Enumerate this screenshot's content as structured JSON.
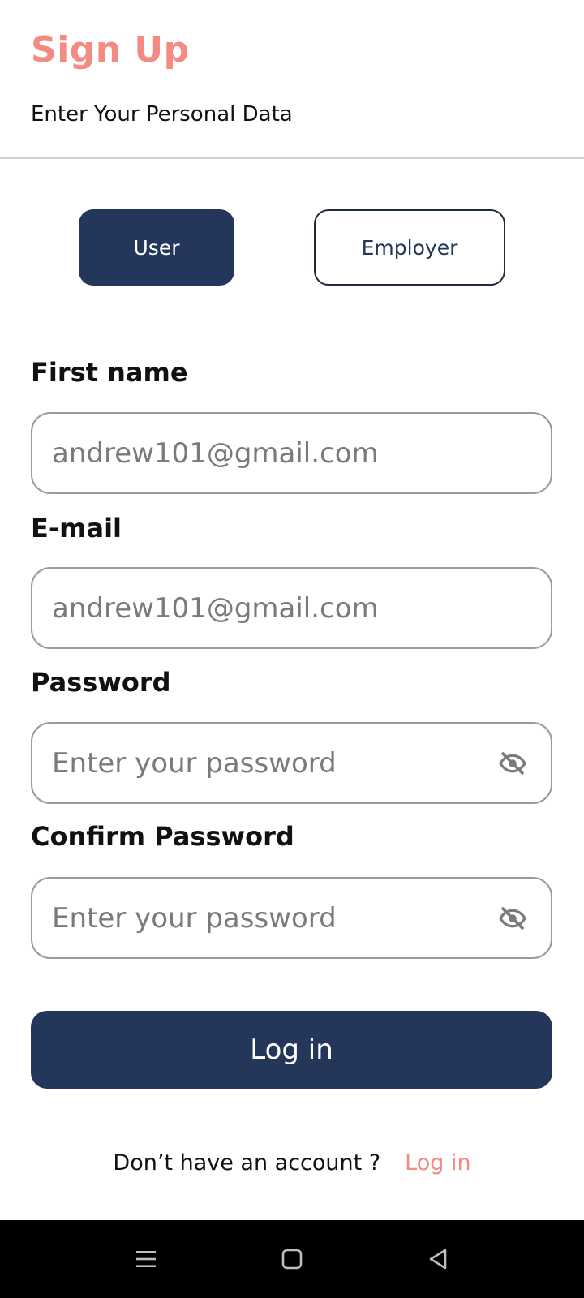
{
  "header": {
    "title": "Sign Up",
    "subtitle": "Enter Your Personal Data"
  },
  "role_toggle": {
    "user_label": "User",
    "employer_label": "Employer",
    "selected": "User"
  },
  "fields": {
    "first_name": {
      "label": "First name",
      "placeholder": "andrew101@gmail.com"
    },
    "email": {
      "label": "E-mail",
      "placeholder": "andrew101@gmail.com"
    },
    "password": {
      "label": "Password",
      "placeholder": "Enter your password",
      "icon": "eye-off-icon"
    },
    "confirm_password": {
      "label": "Confirm Password",
      "placeholder": "Enter your password",
      "icon": "eye-off-icon"
    }
  },
  "primary_button": {
    "label": "Log in"
  },
  "footer": {
    "prompt": "Don’t have an account ?",
    "link": "Log in"
  },
  "system_nav": {
    "icons": [
      "menu-icon",
      "home-icon",
      "back-icon"
    ]
  },
  "colors": {
    "accent": "#F48B82",
    "primary": "#24375A",
    "border": "#9A9A9A",
    "text": "#111111",
    "placeholder": "#7A7A7A"
  }
}
